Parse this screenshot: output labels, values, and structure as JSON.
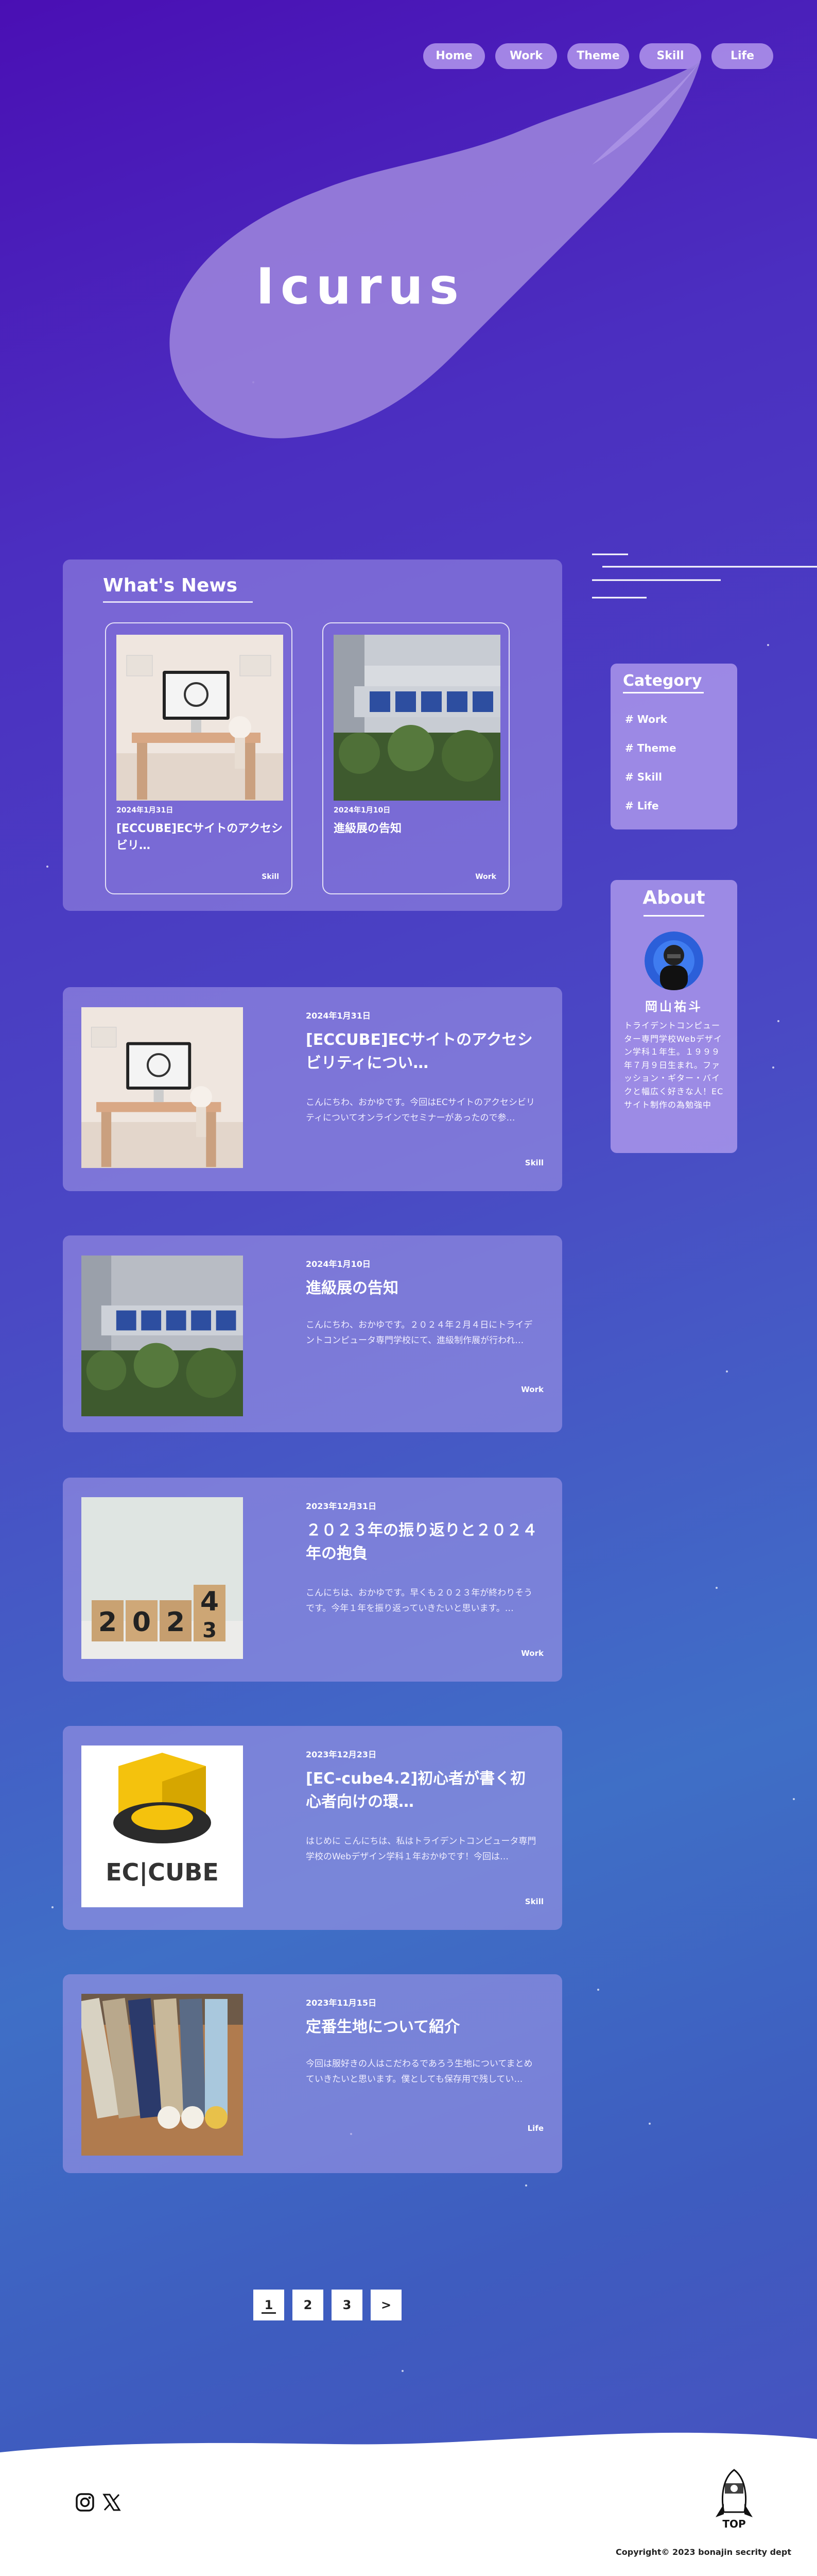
{
  "nav": [
    "Home",
    "Work",
    "Theme",
    "Skill",
    "Life"
  ],
  "hero": {
    "title": "Icurus"
  },
  "news": {
    "heading": "What's News",
    "cards": [
      {
        "date": "2024年1月31日",
        "title": "[ECCUBE]ECサイトのアクセシビリ…",
        "tag": "Skill"
      },
      {
        "date": "2024年1月10日",
        "title": "進級展の告知",
        "tag": "Work"
      }
    ]
  },
  "articles": [
    {
      "date": "2024年1月31日",
      "title": "[ECCUBE]ECサイトのアクセシビリティについ…",
      "excerpt": "こんにちわ、おかゆです。今回はECサイトのアクセシビリティについてオンラインでセミナーがあったので参…",
      "tag": "Skill"
    },
    {
      "date": "2024年1月10日",
      "title": "進級展の告知",
      "excerpt": "こんにちわ、おかゆです。２０２４年２月４日にトライデントコンピュータ専門学校にて、進級制作展が行われ…",
      "tag": "Work"
    },
    {
      "date": "2023年12月31日",
      "title": "２０２３年の振り返りと２０２４年の抱負",
      "excerpt": "こんにちは、おかゆです。早くも２０２３年が終わりそうです。今年１年を振り返っていきたいと思います。…",
      "tag": "Work"
    },
    {
      "date": "2023年12月23日",
      "title": "[EC-cube4.2]初心者が書く初心者向けの環…",
      "excerpt": "はじめに こんにちは、私はトライデントコンピュータ専門学校のWebデザイン学科１年おかゆです！今回は…",
      "tag": "Skill"
    },
    {
      "date": "2023年11月15日",
      "title": "定番生地について紹介",
      "excerpt": "今回は服好きの人はこだわるであろう生地についてまとめていきたいと思います。僕としても保存用で残してい…",
      "tag": "Life"
    }
  ],
  "sidebar": {
    "category": {
      "heading": "Category",
      "items": [
        "Work",
        "Theme",
        "Skill",
        "Life"
      ]
    },
    "about": {
      "heading": "About",
      "name": "岡山祐斗",
      "bio": "トライデントコンピューター専門学校Webデザイン学科１年生。１９９９年７月９日生まれ。ファッション・ギター・バイクと幅広く好きな人！ECサイト制作の為勉強中"
    }
  },
  "pagination": [
    "1",
    "2",
    "3",
    ">"
  ],
  "footer": {
    "top_label": "TOP",
    "copyright": "Copyright© 2023 bonajin secrity dept",
    "sns": [
      "instagram-icon",
      "x-icon"
    ]
  },
  "colors": {
    "accent": "#b296ec",
    "background_top": "#4a0fb4",
    "background_bottom": "#3f6fc6"
  }
}
